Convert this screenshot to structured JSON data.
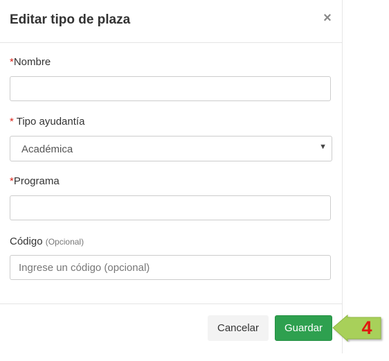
{
  "modal": {
    "title": "Editar tipo de plaza",
    "close_glyph": "×"
  },
  "form": {
    "nombre": {
      "required_mark": "*",
      "label": "Nombre",
      "value": ""
    },
    "tipo_ayudantia": {
      "required_mark": "*",
      "label": " Tipo ayudantía",
      "selected": "Académica",
      "arrow_glyph": "▼"
    },
    "programa": {
      "required_mark": "*",
      "label": "Programa",
      "value": ""
    },
    "codigo": {
      "label": "Código",
      "optional_hint": "(Opcional)",
      "placeholder": "Ingrese un código (opcional)",
      "value": ""
    }
  },
  "footer": {
    "cancel_label": "Cancelar",
    "save_label": "Guardar"
  },
  "annotation": {
    "step_number": "4",
    "arrow_color": "#a8d05a",
    "number_color": "#e0180f"
  },
  "colors": {
    "save_button": "#2ea04f",
    "required_mark": "#d9261c"
  }
}
